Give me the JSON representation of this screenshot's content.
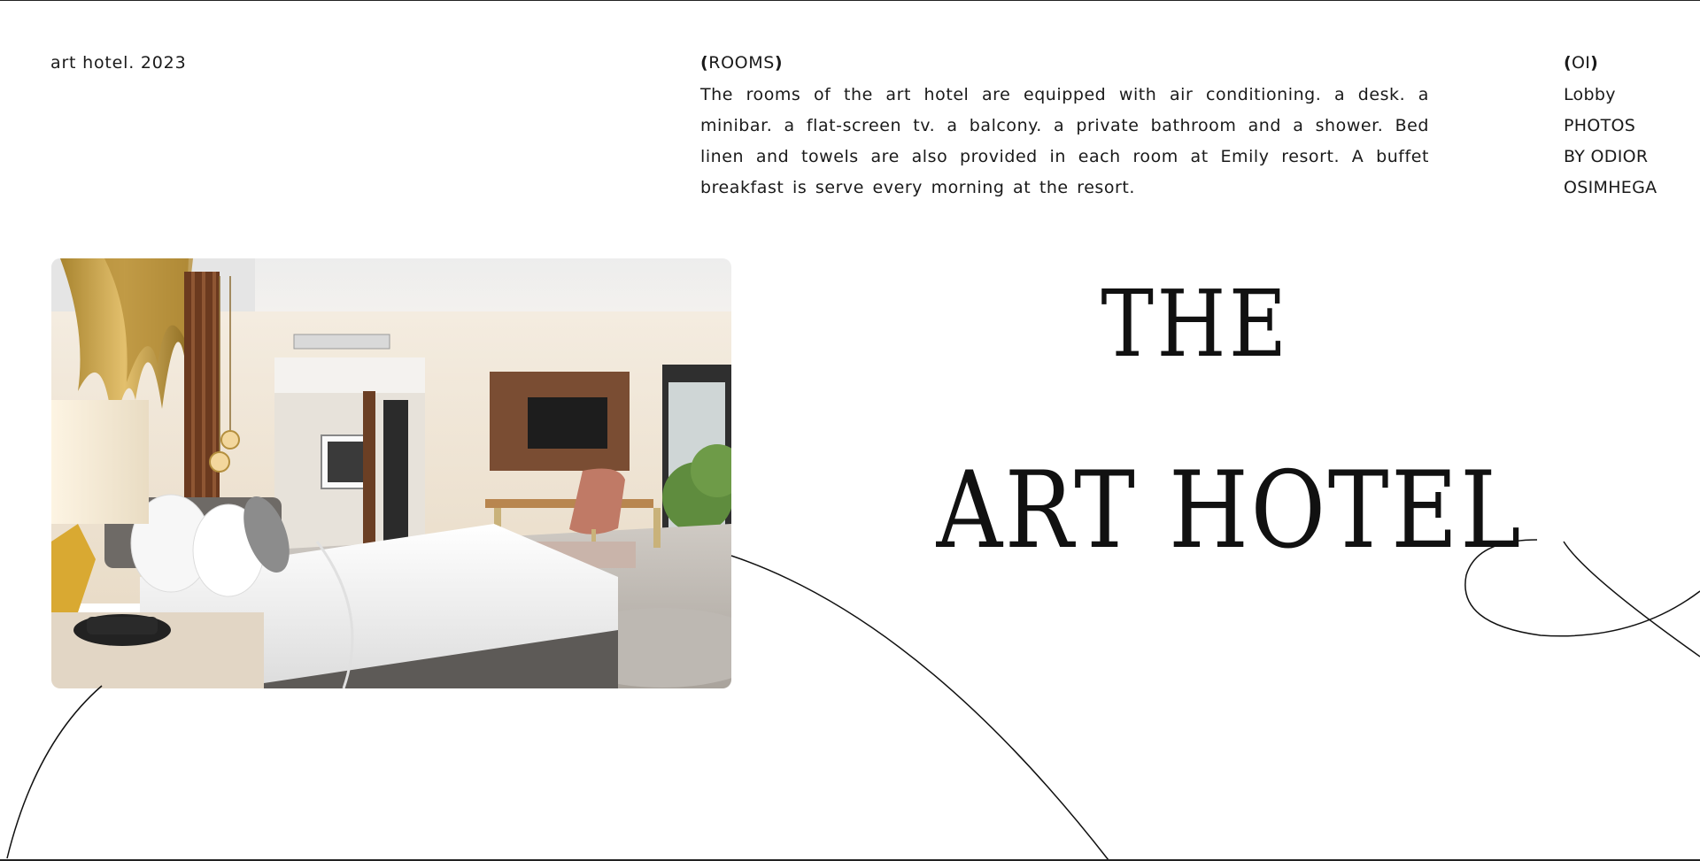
{
  "brand": {
    "text": "art hotel. 2023"
  },
  "rooms": {
    "open_paren": "(",
    "label": "ROOMS",
    "close_paren": ")",
    "body": "The rooms of the art hotel are equipped with air conditioning. a desk. a minibar. a flat-screen tv. a balcony. a private bathroom and a shower. Bed linen and towels are also provided in each room at Emily resort. A buffet breakfast is serve every morning at the resort."
  },
  "credits": {
    "open_paren": "(",
    "number": "OI",
    "close_paren": ")",
    "lines": [
      "Lobby",
      "PHOTOS",
      "BY ODIOR",
      "OSIMHEGA"
    ]
  },
  "hero": {
    "line1": "THE",
    "line2": "ART HOTEL"
  },
  "photo": {
    "subject": "hotel-room-photo"
  }
}
